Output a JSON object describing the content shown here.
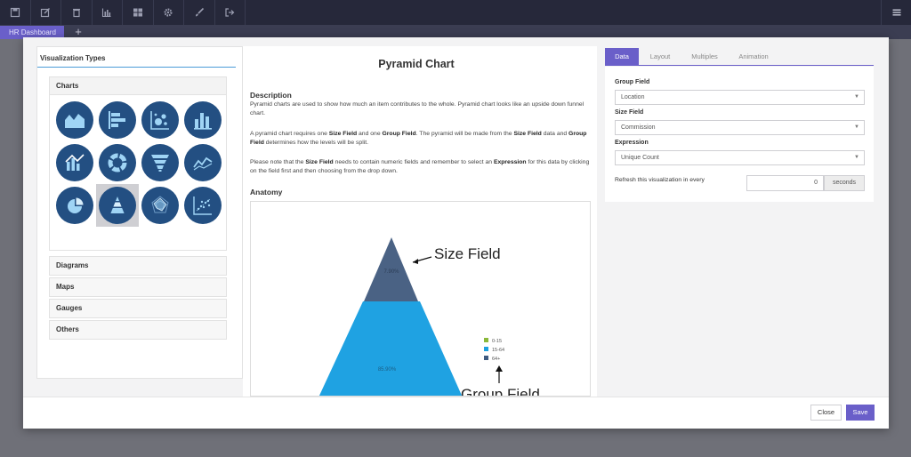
{
  "toolbar": {
    "buttons": [
      {
        "name": "save-icon"
      },
      {
        "name": "edit-icon"
      },
      {
        "name": "trash-icon"
      },
      {
        "name": "bar-chart-icon"
      },
      {
        "name": "dashboard-icon"
      },
      {
        "name": "gear-icon"
      },
      {
        "name": "brush-icon"
      },
      {
        "name": "logout-icon"
      }
    ],
    "menu_icon": "hamburger-menu-icon"
  },
  "dashboard_tabs": {
    "active": "HR Dashboard",
    "add_label": "+"
  },
  "left_panel": {
    "title": "Visualization Types",
    "sections": [
      "Charts",
      "Diagrams",
      "Maps",
      "Gauges",
      "Others"
    ],
    "chart_icons": [
      "area-chart-icon",
      "horizontal-bar-chart-icon",
      "bubble-chart-icon",
      "column-chart-icon",
      "combo-chart-icon",
      "donut-chart-icon",
      "funnel-chart-icon",
      "line-chart-icon",
      "pie-chart-icon",
      "pyramid-chart-icon",
      "radar-chart-icon",
      "scatter-chart-icon"
    ],
    "selected_icon": "pyramid-chart-icon"
  },
  "description": {
    "title": "Pyramid Chart",
    "heading": "Description",
    "p1": "Pyramid charts are used to show how much an item contributes to the whole. Pyramid chart looks like an upside down funnel chart.",
    "p2_a": "A pyramid chart requires one ",
    "p2_b": "Size Field",
    "p2_c": " and one ",
    "p2_d": "Group Field",
    "p2_e": ". The pyramid will be made from the ",
    "p2_f": "Size Field",
    "p2_g": " data and ",
    "p2_h": "Group Field",
    "p2_i": " determines how the levels will be split.",
    "p3_a": "Please note that the ",
    "p3_b": "Size Field",
    "p3_c": " needs to contain numeric fields and remember to select an ",
    "p3_d": "Expression",
    "p3_e": " for this data by clicking on the field first and then choosing from the drop down.",
    "anatomy_heading": "Anatomy"
  },
  "anatomy": {
    "size_label": "Size Field",
    "group_label": "Group Field",
    "top_pct": "7.90%",
    "mid_pct": "85.90%",
    "legend": [
      {
        "label": "0-15",
        "color": "#8ab83a"
      },
      {
        "label": "15-64",
        "color": "#1da1e0"
      },
      {
        "label": "64+",
        "color": "#3d5a80"
      }
    ]
  },
  "settings": {
    "tabs": [
      "Data",
      "Layout",
      "Multiples",
      "Animation"
    ],
    "active_tab": "Data",
    "group_field_label": "Group Field",
    "group_field_value": "Location",
    "size_field_label": "Size Field",
    "size_field_value": "Commission",
    "expression_label": "Expression",
    "expression_value": "Unique Count",
    "refresh_label": "Refresh this visualization in every",
    "refresh_value": "0",
    "refresh_unit": "seconds"
  },
  "footer": {
    "close_label": "Close",
    "save_label": "Save"
  },
  "colors": {
    "accent": "#6a5fc9",
    "icon_circle": "#234f82",
    "topbar": "#26283a"
  }
}
